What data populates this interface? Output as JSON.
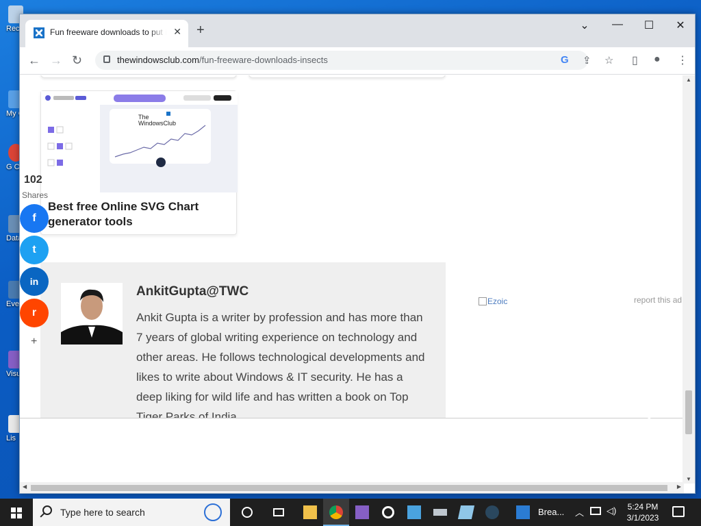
{
  "desktop": {
    "icons": [
      {
        "label": "Rec"
      },
      {
        "label": "My C"
      },
      {
        "label": "G C"
      },
      {
        "label": "Data"
      },
      {
        "label": "Eve"
      },
      {
        "label": "Visu"
      },
      {
        "label": "Lis"
      }
    ]
  },
  "browser": {
    "tab_title": "Fun freeware downloads to put it",
    "tab_close": "✕",
    "new_tab": "+",
    "window_controls": {
      "dropdown": "⌄",
      "minimize": "—",
      "maximize": "☐",
      "close": "✕"
    },
    "url_domain": "thewindowsclub.com",
    "url_path": "/fun-freeware-downloads-insects",
    "nav": {
      "back": "←",
      "forward": "→",
      "reload": "↻"
    },
    "toolbar_icons": {
      "google": "G",
      "share": "⇪",
      "bookmark": "☆",
      "sidepanel": "▯",
      "profile": "●",
      "menu": "⋮"
    }
  },
  "page": {
    "card": {
      "title": "Best free Online SVG Chart generator tools",
      "thumb_logo_line1": "The",
      "thumb_logo_line2": "WindowsClub"
    },
    "share": {
      "count": "102",
      "label": "Shares",
      "more": "+",
      "buttons": [
        {
          "name": "facebook",
          "glyph": "f",
          "color": "#1877f2"
        },
        {
          "name": "twitter",
          "glyph": "t",
          "color": "#1da1f2"
        },
        {
          "name": "linkedin",
          "glyph": "in",
          "color": "#0a66c2"
        },
        {
          "name": "reddit",
          "glyph": "r",
          "color": "#ff4500"
        }
      ]
    },
    "author": {
      "name": "AnkitGupta@TWC",
      "bio": "Ankit Gupta is a writer by profession and has more than 7 years of global writing experience on technology and other areas. He follows technological developments and likes to write about Windows & IT security. He has a deep liking for wild life and has written a book on Top Tiger Parks of India."
    },
    "ad": {
      "ezoic": "Ezoic",
      "report": "report this ad"
    }
  },
  "taskbar": {
    "search_placeholder": "Type here to search",
    "task_label": "Brea...",
    "time": "5:24 PM",
    "date": "3/1/2023"
  }
}
